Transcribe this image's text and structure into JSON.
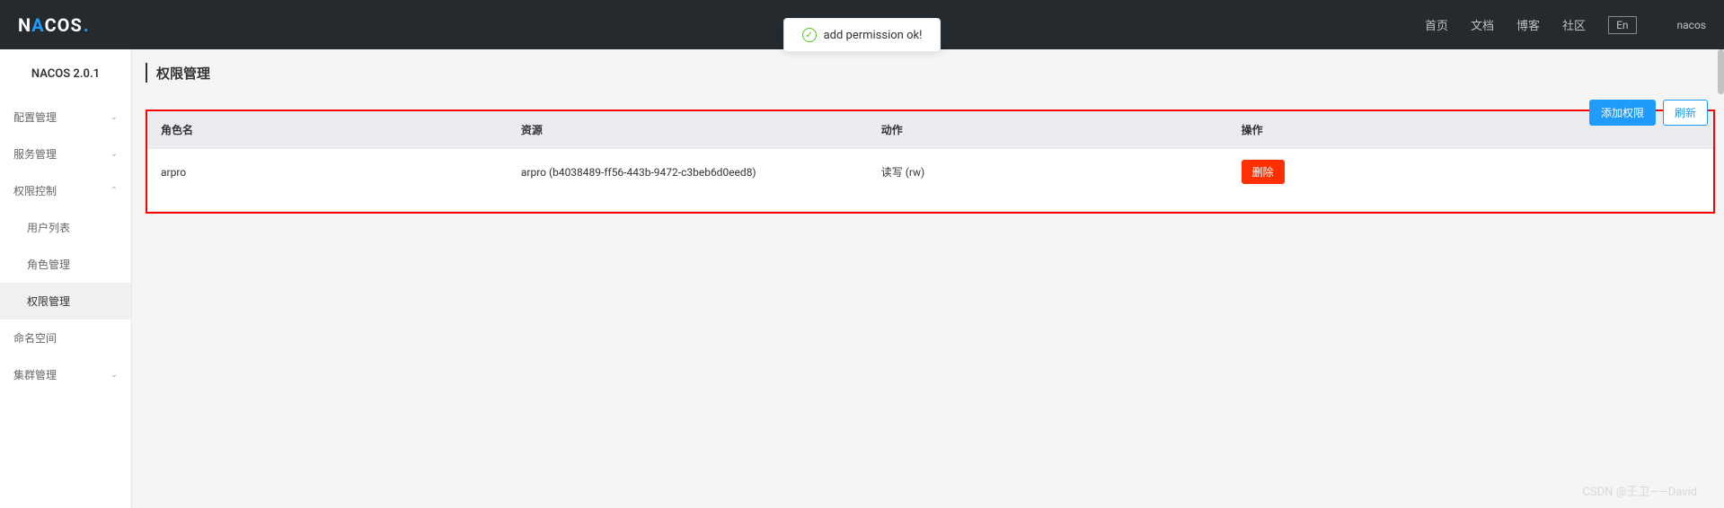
{
  "header": {
    "logo": "NACOS",
    "nav": [
      "首页",
      "文档",
      "博客",
      "社区"
    ],
    "lang": "En",
    "user": "nacos"
  },
  "toast": {
    "message": "add permission ok!"
  },
  "sidebar": {
    "version": "NACOS 2.0.1",
    "menu": {
      "config": "配置管理",
      "service": "服务管理",
      "permission": "权限控制",
      "permission_sub": [
        "用户列表",
        "角色管理",
        "权限管理"
      ],
      "namespace": "命名空间",
      "cluster": "集群管理"
    }
  },
  "page": {
    "title": "权限管理",
    "add_btn": "添加权限",
    "refresh_btn": "刷新"
  },
  "table": {
    "headers": {
      "role": "角色名",
      "resource": "资源",
      "action": "动作",
      "operation": "操作"
    },
    "rows": [
      {
        "role": "arpro",
        "resource": "arpro (b4038489-ff56-443b-9472-c3beb6d0eed8)",
        "action": "读写 (rw)",
        "delete": "删除"
      }
    ]
  },
  "watermark": "CSDN @王卫——David"
}
